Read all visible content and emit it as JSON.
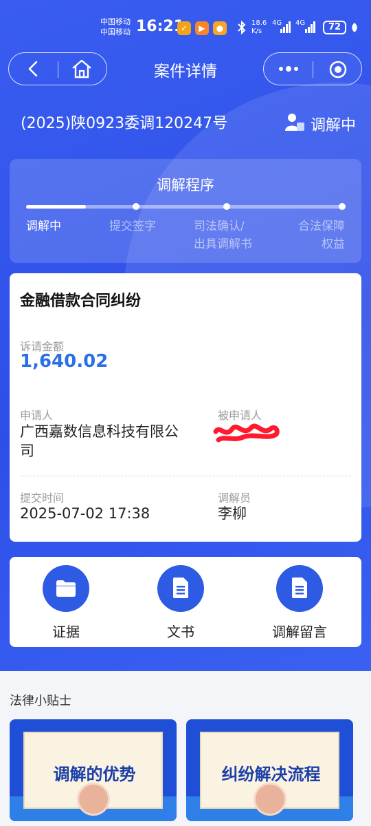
{
  "status_bar": {
    "carrier_1": "中国移动",
    "carrier_2": "中国移动",
    "time": "16:21",
    "net_speed": "18.6 K/s",
    "net_1": "4G",
    "net_2": "4G",
    "battery": "72"
  },
  "nav": {
    "title": "案件详情"
  },
  "case": {
    "number": "(2025)陕0923委调120247号",
    "status": "调解中"
  },
  "progress": {
    "title": "调解程序",
    "current_step": 1,
    "steps": [
      {
        "line1": "调解中",
        "line2": ""
      },
      {
        "line1": "提交签字",
        "line2": ""
      },
      {
        "line1": "司法确认/",
        "line2": "出具调解书"
      },
      {
        "line1": "合法保障",
        "line2": "权益"
      }
    ]
  },
  "detail": {
    "title": "金融借款合同纠纷",
    "amount_label": "诉请金额",
    "amount": "1,640.02",
    "applicant_label": "申请人",
    "applicant_line1": "广西嘉数信息科技有限公",
    "applicant_line2": "司",
    "respondent_label": "被申请人",
    "submit_time_label": "提交时间",
    "submit_time": "2025-07-02 17:38",
    "mediator_label": "调解员",
    "mediator": "李柳"
  },
  "actions": [
    {
      "label": "证据",
      "icon": "folder-icon"
    },
    {
      "label": "文书",
      "icon": "document-icon"
    },
    {
      "label": "调解留言",
      "icon": "document-icon"
    }
  ],
  "tips": {
    "title": "法律小贴士",
    "cards": [
      {
        "label": "调解的优势"
      },
      {
        "label": "纠纷解决流程"
      }
    ]
  },
  "colors": {
    "primary": "#2d4fe8",
    "amount": "#2b6fe6",
    "icon_circle": "#2d5be3"
  }
}
